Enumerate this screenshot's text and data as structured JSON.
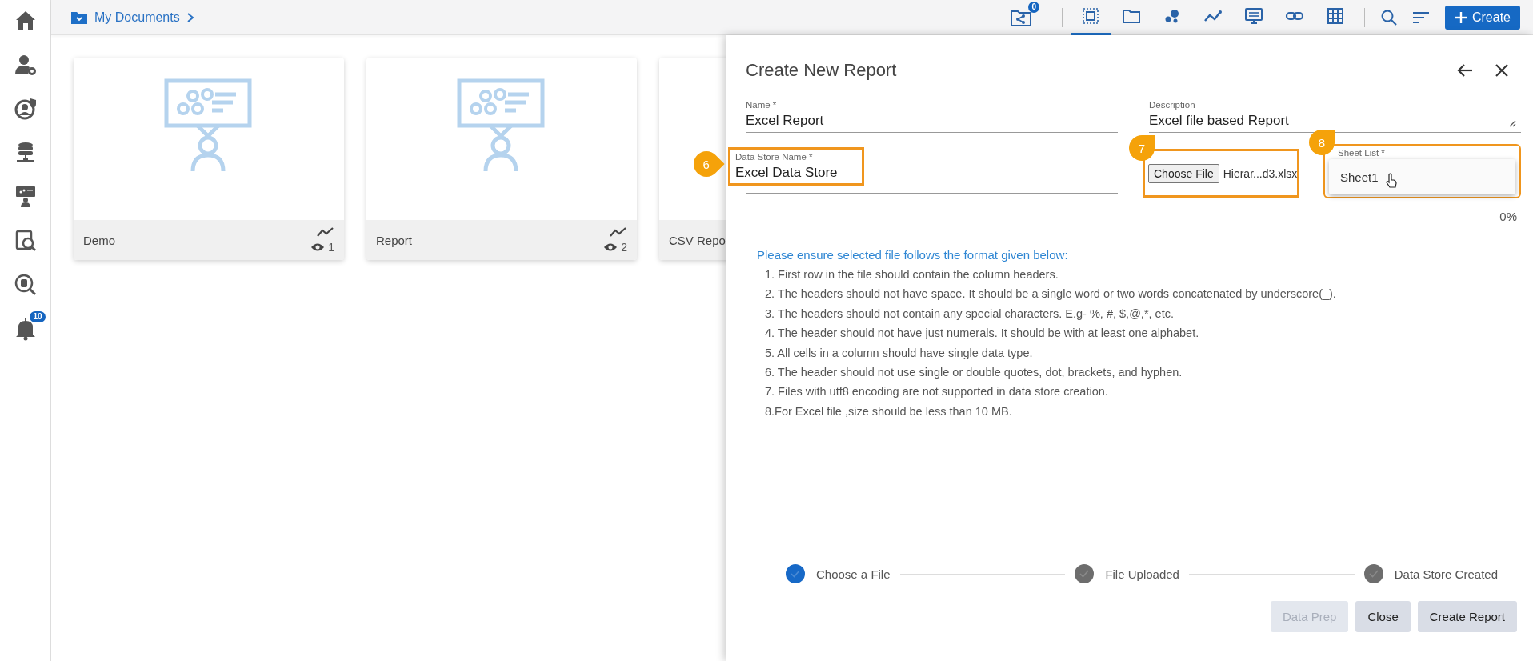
{
  "sidebar": {
    "items": [
      {
        "kind": "home"
      },
      {
        "kind": "user-gear"
      },
      {
        "kind": "user-shield"
      },
      {
        "kind": "database"
      },
      {
        "kind": "presenter"
      },
      {
        "kind": "doc-search"
      },
      {
        "kind": "db-search"
      },
      {
        "kind": "bell",
        "badge": "10"
      }
    ]
  },
  "breadcrumb": {
    "label": "My Documents"
  },
  "toolbar": {
    "share_badge": "0",
    "views": [
      {
        "kind": "select",
        "selected": true
      },
      {
        "kind": "folder",
        "selected": false
      },
      {
        "kind": "dots",
        "selected": false
      },
      {
        "kind": "line",
        "selected": false
      },
      {
        "kind": "screen",
        "selected": false
      },
      {
        "kind": "link",
        "selected": false
      },
      {
        "kind": "grid",
        "selected": false
      }
    ],
    "create_button": "Create"
  },
  "cards": [
    {
      "title": "Demo",
      "views": "1"
    },
    {
      "title": "Report",
      "views": "2"
    },
    {
      "title": "CSV Repo"
    }
  ],
  "panel": {
    "title": "Create New Report",
    "name": {
      "label": "Name *",
      "value": "Excel Report"
    },
    "description": {
      "label": "Description",
      "value": "Excel file based Report"
    },
    "data_store": {
      "label": "Data Store Name *",
      "value": "Excel Data Store",
      "callout": "6"
    },
    "file": {
      "button": "Choose File",
      "file_name": "Hierar...d3.xlsx",
      "callout": "7"
    },
    "sheet_list": {
      "label": "Sheet List *",
      "options": [
        "Sheet1"
      ],
      "callout": "8"
    },
    "progress": "0%",
    "instructions": {
      "heading": "Please ensure selected file follows the format given below:",
      "items": [
        "1. First row in the file should contain the column headers.",
        "2. The headers should not have space. It should be a single word or two words concatenated by underscore(_).",
        "3. The headers should not contain any special characters. E.g- %, #, $,@,*, etc.",
        "4. The header should not have just numerals. It should be with at least one alphabet.",
        "5. All cells in a column should have single data type.",
        "6. The header should not use single or double quotes, dot, brackets, and hyphen.",
        "7. Files with utf8 encoding are not supported in data store creation.",
        "8.For Excel file ,size should be less than 10 MB."
      ]
    },
    "steps": [
      {
        "label": "Choose a File",
        "selected": true
      },
      {
        "label": "File Uploaded",
        "selected": false
      },
      {
        "label": "Data Store Created",
        "selected": false
      }
    ],
    "buttons": [
      {
        "label": "Data Prep",
        "disabled": true
      },
      {
        "label": "Close",
        "disabled": false
      },
      {
        "label": "Create Report",
        "disabled": false
      }
    ]
  }
}
